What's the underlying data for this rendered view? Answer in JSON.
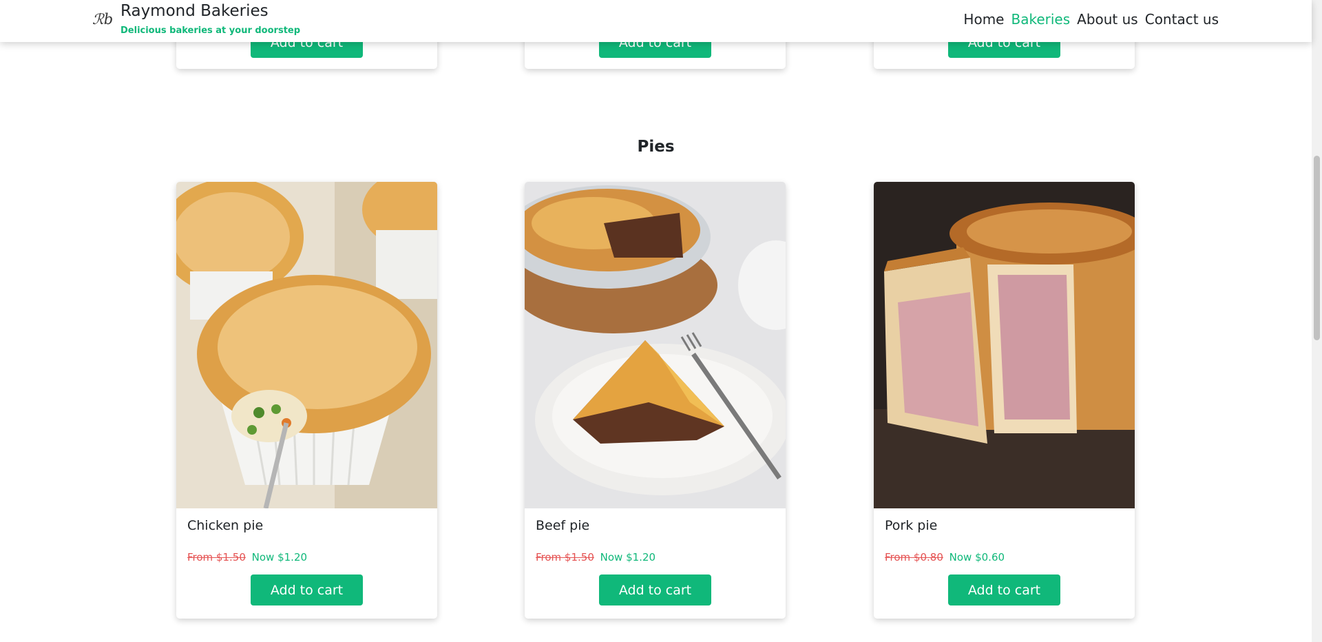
{
  "brand": {
    "logo": "ℛb",
    "name": "Raymond Bakeries",
    "tagline": "Delicious bakeries at your doorstep"
  },
  "nav": {
    "links": [
      "Home",
      "Bakeries",
      "About us",
      "Contact us"
    ],
    "active": "Bakeries"
  },
  "previous_section": {
    "button_label": "Add to cart"
  },
  "pies": {
    "heading": "Pies",
    "items": [
      {
        "name": "Chicken pie",
        "old_price": "From $1.50",
        "new_price": "Now $1.20",
        "button": "Add to cart",
        "image": "chicken-pie-photo"
      },
      {
        "name": "Beef pie",
        "old_price": "From $1.50",
        "new_price": "Now $1.20",
        "button": "Add to cart",
        "image": "beef-pie-photo"
      },
      {
        "name": "Pork pie",
        "old_price": "From $0.80",
        "new_price": "Now $0.60",
        "button": "Add to cart",
        "image": "pork-pie-photo"
      }
    ]
  },
  "colors": {
    "accent": "#10b87a",
    "strike": "#e55353",
    "text": "#212529"
  }
}
